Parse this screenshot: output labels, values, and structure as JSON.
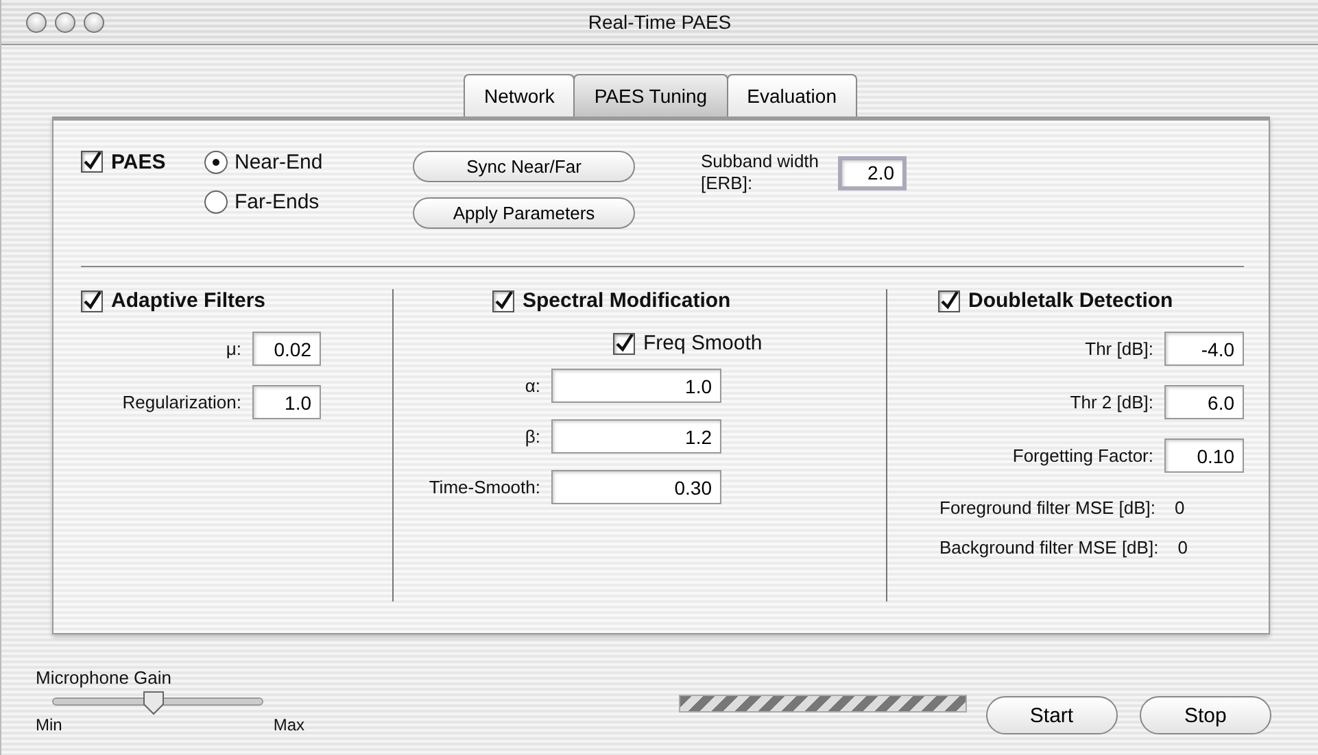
{
  "window": {
    "title": "Real-Time PAES"
  },
  "tabs": [
    {
      "label": "Network",
      "selected": false
    },
    {
      "label": "PAES Tuning",
      "selected": true
    },
    {
      "label": "Evaluation",
      "selected": false
    }
  ],
  "paes": {
    "label": "PAES",
    "checked": true
  },
  "mode_options": [
    {
      "label": "Near-End",
      "selected": true
    },
    {
      "label": "Far-Ends",
      "selected": false
    }
  ],
  "buttons": [
    "Sync Near/Far",
    "Apply Parameters"
  ],
  "subband": {
    "label": "Subband width [ERB]:",
    "value": "2.0"
  },
  "sections": [
    {
      "title": "Adaptive Filters",
      "checked": true,
      "fields": [
        {
          "label": "μ:",
          "value": "0.02"
        },
        {
          "label": "Regularization:",
          "value": "1.0"
        }
      ]
    },
    {
      "title": "Spectral Modification",
      "checked": true,
      "sub_checkbox": {
        "label": "Freq Smooth",
        "checked": true
      },
      "fields": [
        {
          "label": "α:",
          "value": "1.0"
        },
        {
          "label": "β:",
          "value": "1.2"
        },
        {
          "label": "Time-Smooth:",
          "value": "0.30"
        }
      ]
    },
    {
      "title": "Doubletalk Detection",
      "checked": true,
      "fields": [
        {
          "label": "Thr [dB]:",
          "value": "-4.0"
        },
        {
          "label": "Thr 2 [dB]:",
          "value": "6.0"
        },
        {
          "label": "Forgetting Factor:",
          "value": "0.10"
        }
      ],
      "readouts": [
        {
          "label": "Foreground filter MSE [dB]:",
          "value": "0"
        },
        {
          "label": "Background filter MSE [dB]:",
          "value": "0"
        }
      ]
    }
  ],
  "microphone_gain": {
    "label": "Microphone Gain",
    "level": 0.48,
    "min_label": "Min",
    "max_label": "Max"
  },
  "progress": {
    "indeterminate": true
  },
  "actions": [
    "Start",
    "Stop"
  ]
}
